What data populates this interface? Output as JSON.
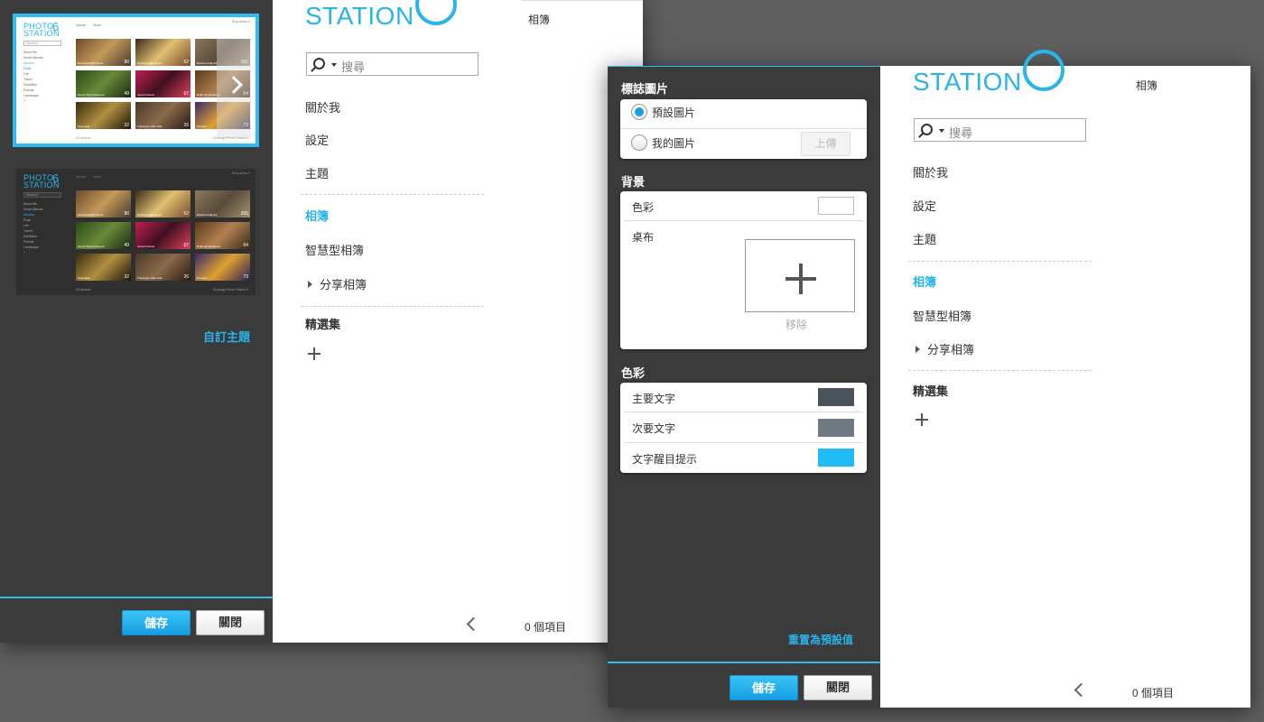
{
  "back_window": {
    "custom_theme_link": "自訂主題",
    "save_label": "儲存",
    "close_label": "關閉",
    "sidebar": {
      "search_placeholder": "搜尋",
      "items": [
        "關於我",
        "設定",
        "主題",
        "相簿",
        "智慧型相簿",
        "分享相簿",
        "精選集"
      ],
      "active": "相簿"
    },
    "content": {
      "title": "相簿",
      "count_label": "0 個項目"
    }
  },
  "theme_thumbnails": {
    "logo_top": "PHOTO",
    "logo_bottom": "STATION",
    "logo_number": "6",
    "search_placeholder": "Search",
    "nav": [
      "About Me",
      "Smart Albums",
      "",
      "Food",
      "Life",
      "Travel",
      "Exhibition",
      "Portrait",
      "Landscape",
      "+"
    ],
    "top_links": [
      "Upload",
      "Share"
    ],
    "top_right": "Blog   admin ▾",
    "section": "Albums",
    "albums": [
      {
        "name": "Dashboardd@Taiwan",
        "count": "86"
      },
      {
        "name": "Dashboard@Taiwan",
        "count": "52"
      },
      {
        "name": "Dashboard@Life",
        "count": "265"
      },
      {
        "name": "Hai Air Street Museum",
        "count": "49"
      },
      {
        "name": "Jewel Festival",
        "count": "67"
      },
      {
        "name": "Buffet @ Singapore",
        "count": "64"
      },
      {
        "name": "Spangalla",
        "count": "32"
      },
      {
        "name": "Travelogs Little Cafe",
        "count": "26"
      },
      {
        "name": "Hi Hotel",
        "count": "73"
      }
    ],
    "footer_left": "46 Albums",
    "footer_right": "Synology Photo Station 6"
  },
  "front_window": {
    "logo_image_title": "標誌圖片",
    "default_image_label": "預設圖片",
    "my_image_label": "我的圖片",
    "upload_label": "上傳",
    "background_title": "背景",
    "bg_color_label": "色彩",
    "tablecloth_label": "桌布",
    "remove_label": "移除",
    "colors_title": "色彩",
    "primary_text_label": "主要文字",
    "secondary_text_label": "次要文字",
    "highlight_text_label": "文字醒目提示",
    "reset_label": "重置為預設值",
    "save_label": "儲存",
    "close_label": "關閉",
    "colors": {
      "background": "#ffffff",
      "primary_text": "#4a535c",
      "secondary_text": "#717a83",
      "highlight_text": "#1fbcf5"
    },
    "sidebar": {
      "logo_text": "STATION",
      "search_placeholder": "搜尋",
      "items": [
        "關於我",
        "設定",
        "主題",
        "相簿",
        "智慧型相簿",
        "分享相簿",
        "精選集"
      ],
      "active": "相簿"
    },
    "content": {
      "title": "相簿",
      "count_label": "0 個項目"
    }
  },
  "back_logo_text": "STATION"
}
